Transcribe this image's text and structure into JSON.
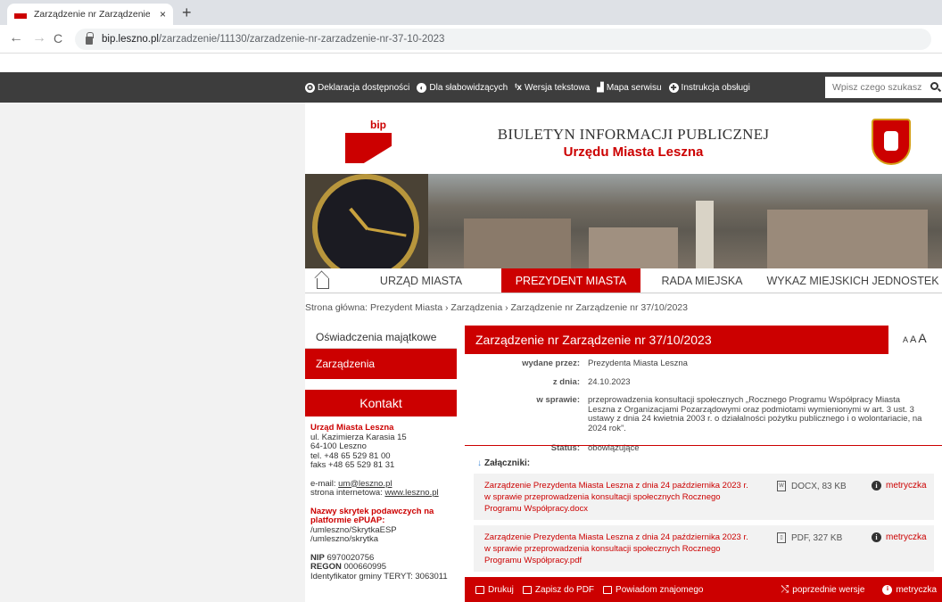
{
  "browser": {
    "tab_title": "Zarządzenie nr Zarządzenie nr 3",
    "tab_close": "×",
    "new_tab": "+",
    "back": "←",
    "forward": "→",
    "reload": "C",
    "url_domain": "bip.leszno.pl",
    "url_path": "/zarzadzenie/11130/zarzadzenie-nr-zarzadzenie-nr-37-10-2023"
  },
  "topbar": {
    "items": [
      {
        "label": "Deklaracja dostępności",
        "icon": "accessibility-icon"
      },
      {
        "label": "Dla słabowidzących",
        "icon": "contrast-icon"
      },
      {
        "label": "Wersja tekstowa",
        "icon": "text-version-icon"
      },
      {
        "label": "Mapa serwisu",
        "icon": "sitemap-icon"
      },
      {
        "label": "Instrukcja obsługi",
        "icon": "help-icon"
      }
    ],
    "search_placeholder": "Wpisz czego szukasz"
  },
  "header": {
    "bip_logo": "bip",
    "title": "BIULETYN INFORMACJI PUBLICZNEJ",
    "subtitle": "Urzędu Miasta Leszna"
  },
  "menu": {
    "items": [
      {
        "label": "URZĄD MIASTA",
        "active": false
      },
      {
        "label": "PREZYDENT MIASTA",
        "active": true
      },
      {
        "label": "RADA MIEJSKA",
        "active": false
      },
      {
        "label": "WYKAZ MIEJSKICH JEDNOSTEK",
        "active": false
      }
    ]
  },
  "breadcrumb": "Strona główna: Prezydent Miasta  › Zarządzenia  › Zarządzenie nr Zarządzenie nr 37/10/2023",
  "sidebar": {
    "item1": "Oświadczenia majątkowe",
    "item2": "Zarządzenia",
    "kontakt_title": "Kontakt",
    "org": "Urząd Miasta Leszna",
    "addr1": "ul. Kazimierza Karasia 15",
    "addr2": "64-100 Leszno",
    "tel": "tel. +48 65 529 81 00",
    "fax": "faks +48 65 529 81 31",
    "email_label": "e-mail: ",
    "email": "um@leszno.pl",
    "www_label": "strona internetowa: ",
    "www": "www.leszno.pl",
    "skrytki_title": "Nazwy skrytek podawczych na platformie ePUAP:",
    "skrytka1": "/umleszno/SkrytkaESP",
    "skrytka2": "/umleszno/skrytka",
    "nip_label": "NIP",
    "nip": " 6970020756",
    "regon_label": "REGON",
    "regon": " 000660995",
    "teryt": "Identyfikator gminy TERYT: 3063011"
  },
  "main": {
    "title": "Zarządzenie nr Zarządzenie nr 37/10/2023",
    "font_small": "A",
    "font_medium": "A",
    "font_large": "A",
    "meta": [
      {
        "label": "wydane przez:",
        "value": "Prezydenta Miasta Leszna"
      },
      {
        "label": "z dnia:",
        "value": "24.10.2023"
      },
      {
        "label": "w sprawie:",
        "value": "przeprowadzenia konsultacji społecznych „Rocznego Programu Współpracy Miasta Leszna z Organizacjami Pozarządowymi oraz podmiotami wymienionymi w art. 3 ust. 3 ustawy z dnia 24 kwietnia 2003 r. o działalności pożytku publicznego i o wolontariacie, na 2024 rok”."
      },
      {
        "label": "Status:",
        "value": "obowiązujące"
      }
    ],
    "attachments_title": "Załączniki:",
    "attachments": [
      {
        "title": "Zarządzenie Prezydenta Miasta Leszna z dnia 24 października 2023 r. w sprawie przeprowadzenia konsultacji społecznych Rocznego Programu Współpracy.docx",
        "type": "DOCX, 83 KB",
        "metryczka": "metryczka"
      },
      {
        "title": "Zarządzenie Prezydenta Miasta Leszna z dnia 24 października 2023 r. w sprawie przeprowadzenia konsultacji społecznych Rocznego Programu Współpracy.pdf",
        "type": "PDF, 327 KB",
        "metryczka": "metryczka"
      }
    ]
  },
  "footer": {
    "print": "Drukuj",
    "pdf": "Zapisz do PDF",
    "notify": "Powiadom znajomego",
    "versions": "poprzednie wersje",
    "metryczka": "metryczka"
  },
  "colors": {
    "brand_red": "#cc0000",
    "topbar": "#3d3d3d"
  }
}
